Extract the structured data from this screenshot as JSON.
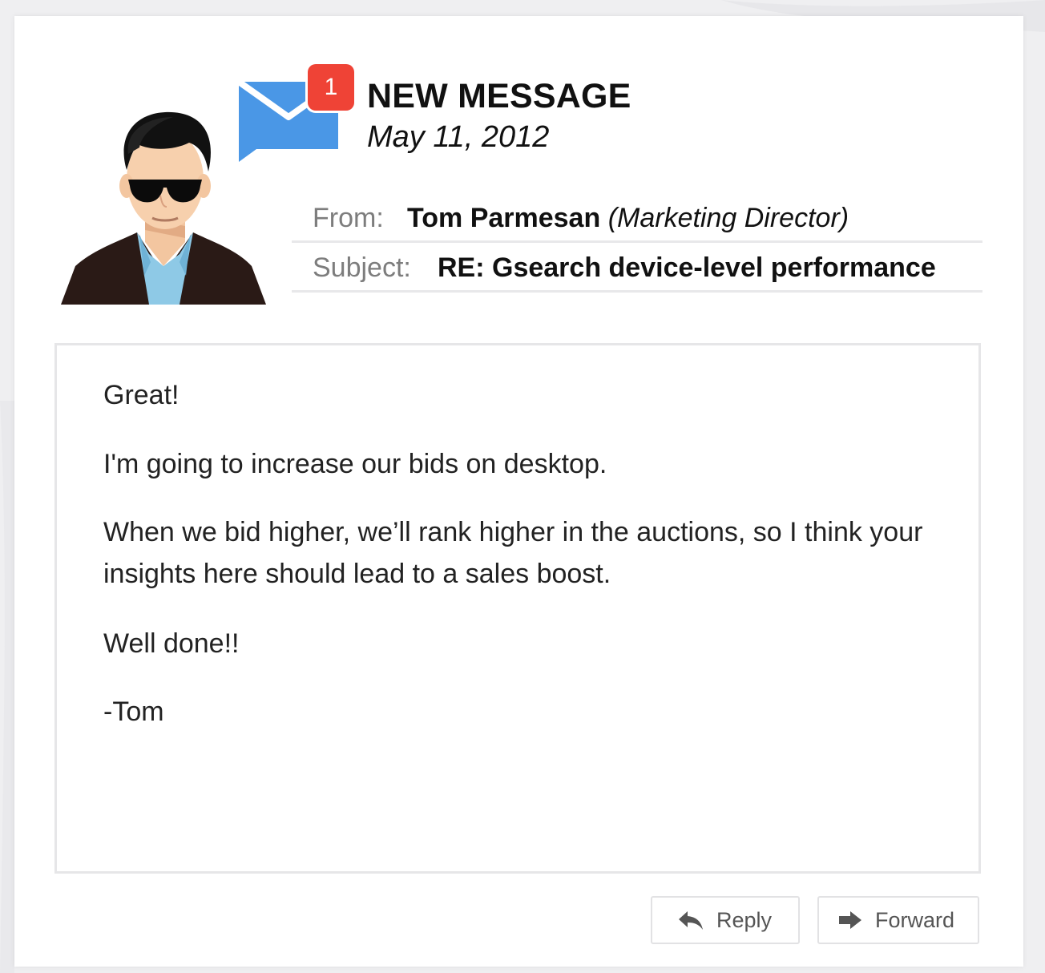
{
  "header": {
    "badge_count": "1",
    "title": "NEW MESSAGE",
    "date": "May 11, 2012"
  },
  "from": {
    "label": "From:",
    "name": "Tom Parmesan",
    "role": "(Marketing Director)"
  },
  "subject": {
    "label": "Subject:",
    "value": "RE: Gsearch device-level performance"
  },
  "body": {
    "paragraphs": [
      "Great!",
      "I'm going to increase our bids on desktop.",
      "When we bid higher, we’ll rank higher in the auctions, so I think your insights here should lead to a sales boost.",
      "Well done!!",
      "-Tom"
    ]
  },
  "actions": {
    "reply_label": "Reply",
    "forward_label": "Forward"
  },
  "icons": {
    "avatar": "person-avatar-icon",
    "envelope": "envelope-icon",
    "reply": "reply-arrow-icon",
    "forward": "forward-arrow-icon"
  },
  "colors": {
    "envelope": "#4a97e6",
    "badge": "#ef4336"
  }
}
